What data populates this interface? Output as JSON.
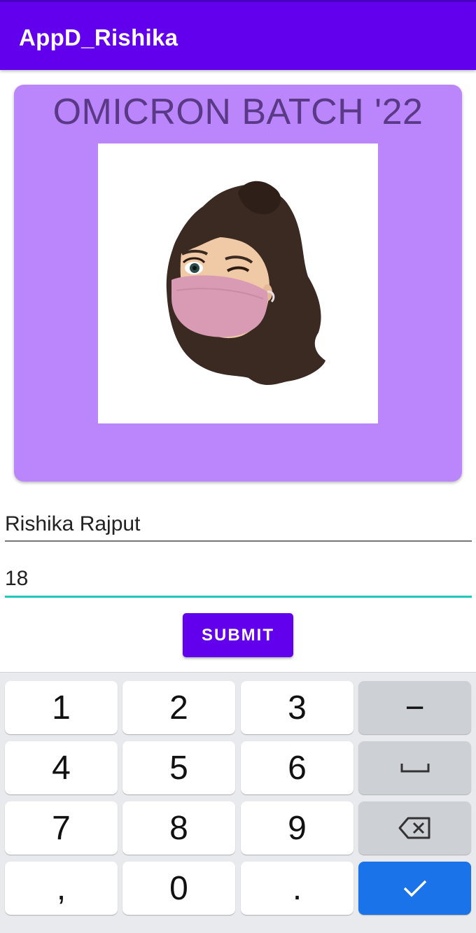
{
  "appbar": {
    "title": "AppD_Rishika"
  },
  "card": {
    "title": "OMICRON BATCH '22"
  },
  "form": {
    "name_value": "Rishika Rajput",
    "age_value": "18",
    "submit_label": "SUBMIT"
  },
  "keyboard": {
    "k1": "1",
    "k2": "2",
    "k3": "3",
    "minus": "−",
    "k4": "4",
    "k5": "5",
    "k6": "6",
    "k7": "7",
    "k8": "8",
    "k9": "9",
    "comma": ",",
    "k0": "0",
    "period": "."
  },
  "colors": {
    "appbar": "#6200ee",
    "card": "#bb86fc",
    "focus_underline": "#1fc8b8",
    "enter_key": "#1a73e8"
  }
}
